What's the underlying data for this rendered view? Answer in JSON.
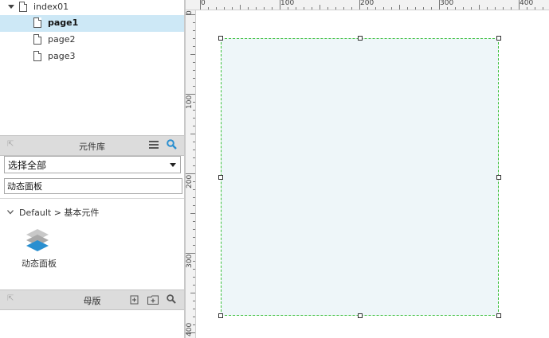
{
  "sitemap": {
    "root": "index01",
    "pages": [
      {
        "label": "page1",
        "selected": true
      },
      {
        "label": "page2",
        "selected": false
      },
      {
        "label": "page3",
        "selected": false
      }
    ]
  },
  "library": {
    "title": "元件库",
    "select_value": "选择全部",
    "search_value": "动态面板",
    "breadcrumb": "Default > 基本元件",
    "widget_label": "动态面板"
  },
  "masters": {
    "title": "母版"
  },
  "ruler": {
    "h_ticks": [
      "0",
      "100",
      "200",
      "300",
      "400"
    ],
    "v_ticks": [
      "0",
      "100",
      "200",
      "300",
      "400"
    ]
  },
  "colors": {
    "selected_row": "#cde8f6",
    "accent_blue": "#2a8fd0",
    "panel_fill": "#eef6f9",
    "panel_border": "#3cc03c"
  }
}
